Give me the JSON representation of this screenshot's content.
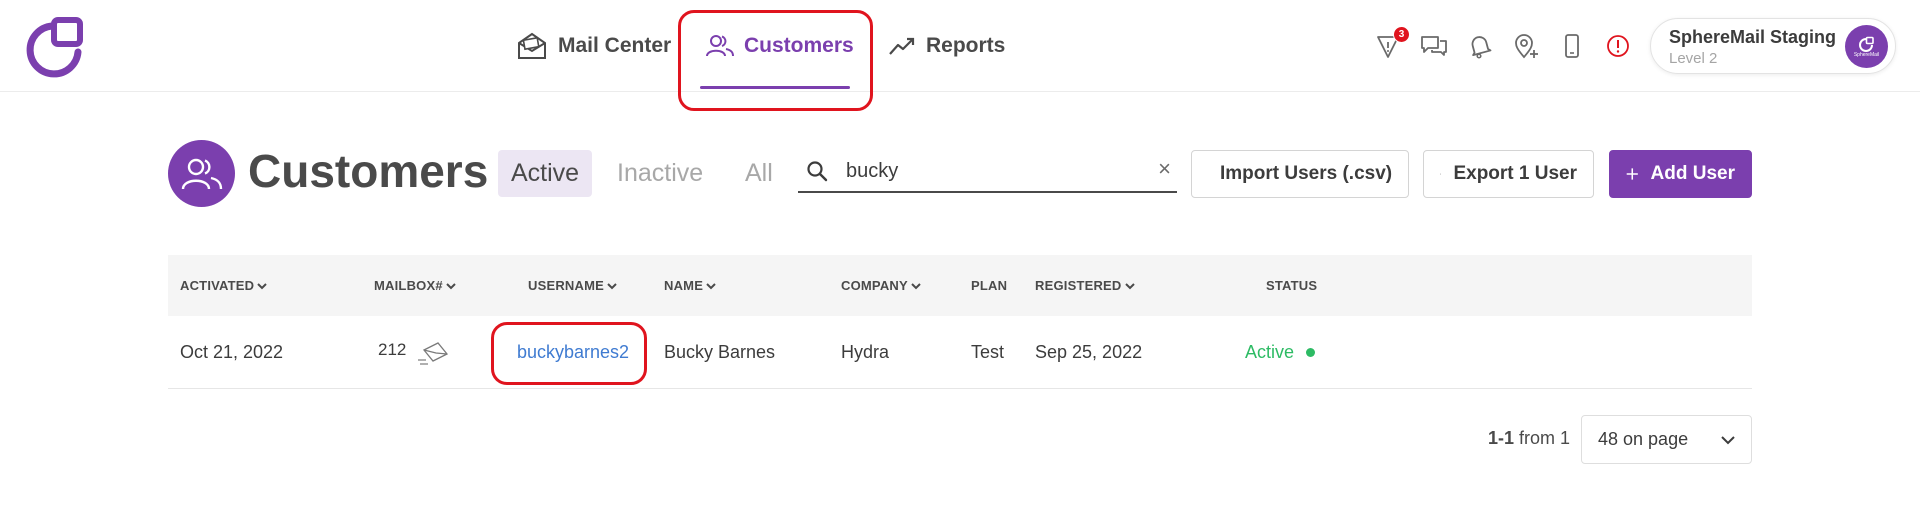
{
  "colors": {
    "brand": "#7b3fae",
    "link": "#3f7bd1",
    "status_active": "#2dbb64",
    "highlight": "#e0141e"
  },
  "nav": {
    "items": [
      {
        "label": "Mail Center",
        "icon": "mail-center-icon"
      },
      {
        "label": "Customers",
        "icon": "customers-icon",
        "selected": true
      },
      {
        "label": "Reports",
        "icon": "reports-icon"
      }
    ],
    "alerts_badge": "3"
  },
  "account": {
    "name": "SphereMail Staging",
    "level": "Level 2",
    "avatar_caption": "SphereMail"
  },
  "page": {
    "title": "Customers",
    "filters": [
      "Active",
      "Inactive",
      "All"
    ],
    "selected_filter": "Active"
  },
  "search": {
    "value": "bucky"
  },
  "actions": {
    "import_label": "Import Users (.csv)",
    "export_label": "Export 1 User",
    "add_label": "Add User"
  },
  "table": {
    "columns": [
      "ACTIVATED",
      "MAILBOX#",
      "USERNAME",
      "NAME",
      "COMPANY",
      "PLAN",
      "REGISTERED",
      "STATUS"
    ],
    "rows": [
      {
        "activated": "Oct 21, 2022",
        "mailbox": "212",
        "username": "buckybarnes2",
        "name": "Bucky Barnes",
        "company": "Hydra",
        "plan": "Test",
        "registered": "Sep 25, 2022",
        "status": "Active"
      }
    ]
  },
  "pagination": {
    "range": "1-1",
    "from_label": "from 1",
    "per_page": "48 on page"
  }
}
